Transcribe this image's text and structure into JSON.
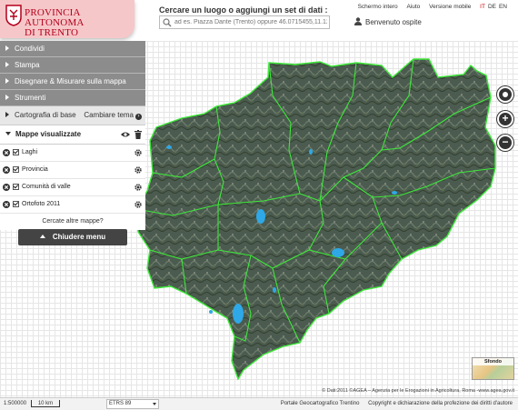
{
  "header": {
    "logo_line1": "PROVINCIA AUTONOMA",
    "logo_line2": "DI TRENTO",
    "search_title": "Cercare un luogo o aggiungi un set di dati :",
    "search_placeholder": "ad es. Piazza Dante (Trento) oppure 46.0715455,11.1203",
    "links": {
      "fullscreen": "Schermo intero",
      "help": "Aiuto",
      "mobile": "Versione mobile"
    },
    "languages": [
      "IT",
      "DE",
      "EN"
    ],
    "user_label": "Benvenuto ospite"
  },
  "sidebar": {
    "items": [
      {
        "label": "Condividi"
      },
      {
        "label": "Stampa"
      },
      {
        "label": "Disegnare & Misurare sulla mappa"
      },
      {
        "label": "Strumenti"
      }
    ],
    "basemap": {
      "label": "Cartografia di base",
      "change_label": "Cambiare tema"
    },
    "maps_panel": {
      "title": "Mappe visualizzate",
      "layers": [
        {
          "name": "Laghi"
        },
        {
          "name": "Provincia"
        },
        {
          "name": "Comunità di valle"
        },
        {
          "name": "Ortofoto 2011"
        }
      ],
      "more_maps": "Cercate altre mappe?"
    },
    "close_menu": "Chiudere menu"
  },
  "map": {
    "background_thumbnail_label": "Sfondo",
    "credits": "© Dati:2011 ©AGEA – Agenzia per le Erogazioni in Agricoltura, Roma -www.agea.gov.it",
    "colors": {
      "border_lines": "#3ee83a",
      "lakes": "#2ea8e6",
      "terrain": "#4a5a4e"
    }
  },
  "footer": {
    "scale": "1:500000",
    "scale_bar": "10 km",
    "crs": "ETRS 89",
    "links": [
      "Portale Geocartografico Trentino",
      "Copyright e dichiarazione della profezione dei diritti d'autore"
    ]
  }
}
